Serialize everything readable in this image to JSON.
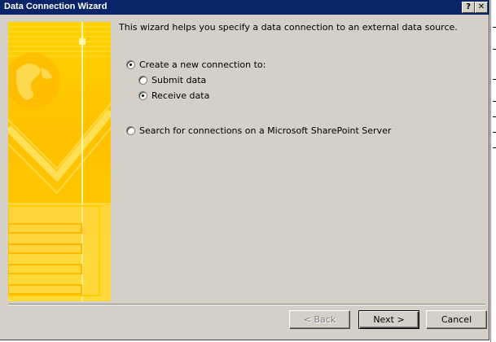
{
  "window": {
    "title": "Data Connection Wizard",
    "help_glyph": "?",
    "close_glyph": "✕"
  },
  "content": {
    "intro": "This wizard helps you specify a data connection to an external data source.",
    "options": {
      "create_new": {
        "label": "Create a new connection to:",
        "checked": true
      },
      "submit": {
        "label": "Submit data",
        "checked": false
      },
      "receive": {
        "label": "Receive data",
        "checked": true
      },
      "sharepoint": {
        "label": "Search for connections on a Microsoft SharePoint Server",
        "checked": false
      }
    }
  },
  "buttons": {
    "back": "< Back",
    "next": "Next >",
    "cancel": "Cancel"
  },
  "colors": {
    "titlebar": "#0a246a",
    "dialog_bg": "#d4d0c8",
    "banner_yellow": "#ffc800"
  }
}
